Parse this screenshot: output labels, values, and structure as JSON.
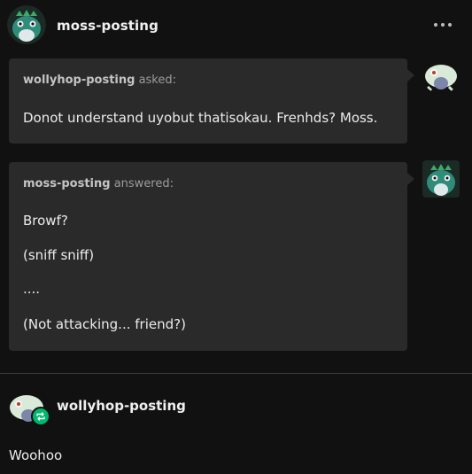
{
  "post": {
    "author": "moss-posting",
    "menu_icon": "more-dots-icon"
  },
  "ask": {
    "asker": "wollyhop-posting",
    "asked_label": "asked:",
    "question": "Donot understand uyobut thatisokau. Frenhds? Moss."
  },
  "answer": {
    "answerer": "moss-posting",
    "answered_label": "answered:",
    "lines": [
      "Browf?",
      "(sniff sniff)",
      "....",
      "(Not attacking... friend?)"
    ]
  },
  "reblog": {
    "author": "wollyhop-posting",
    "badge_icon": "reblog-icon",
    "badge_color": "#00b86b",
    "body": "Woohoo"
  },
  "colors": {
    "background": "#111111",
    "bubble": "#2a2a2a",
    "text": "#ececec",
    "muted": "#9c9c9c"
  }
}
